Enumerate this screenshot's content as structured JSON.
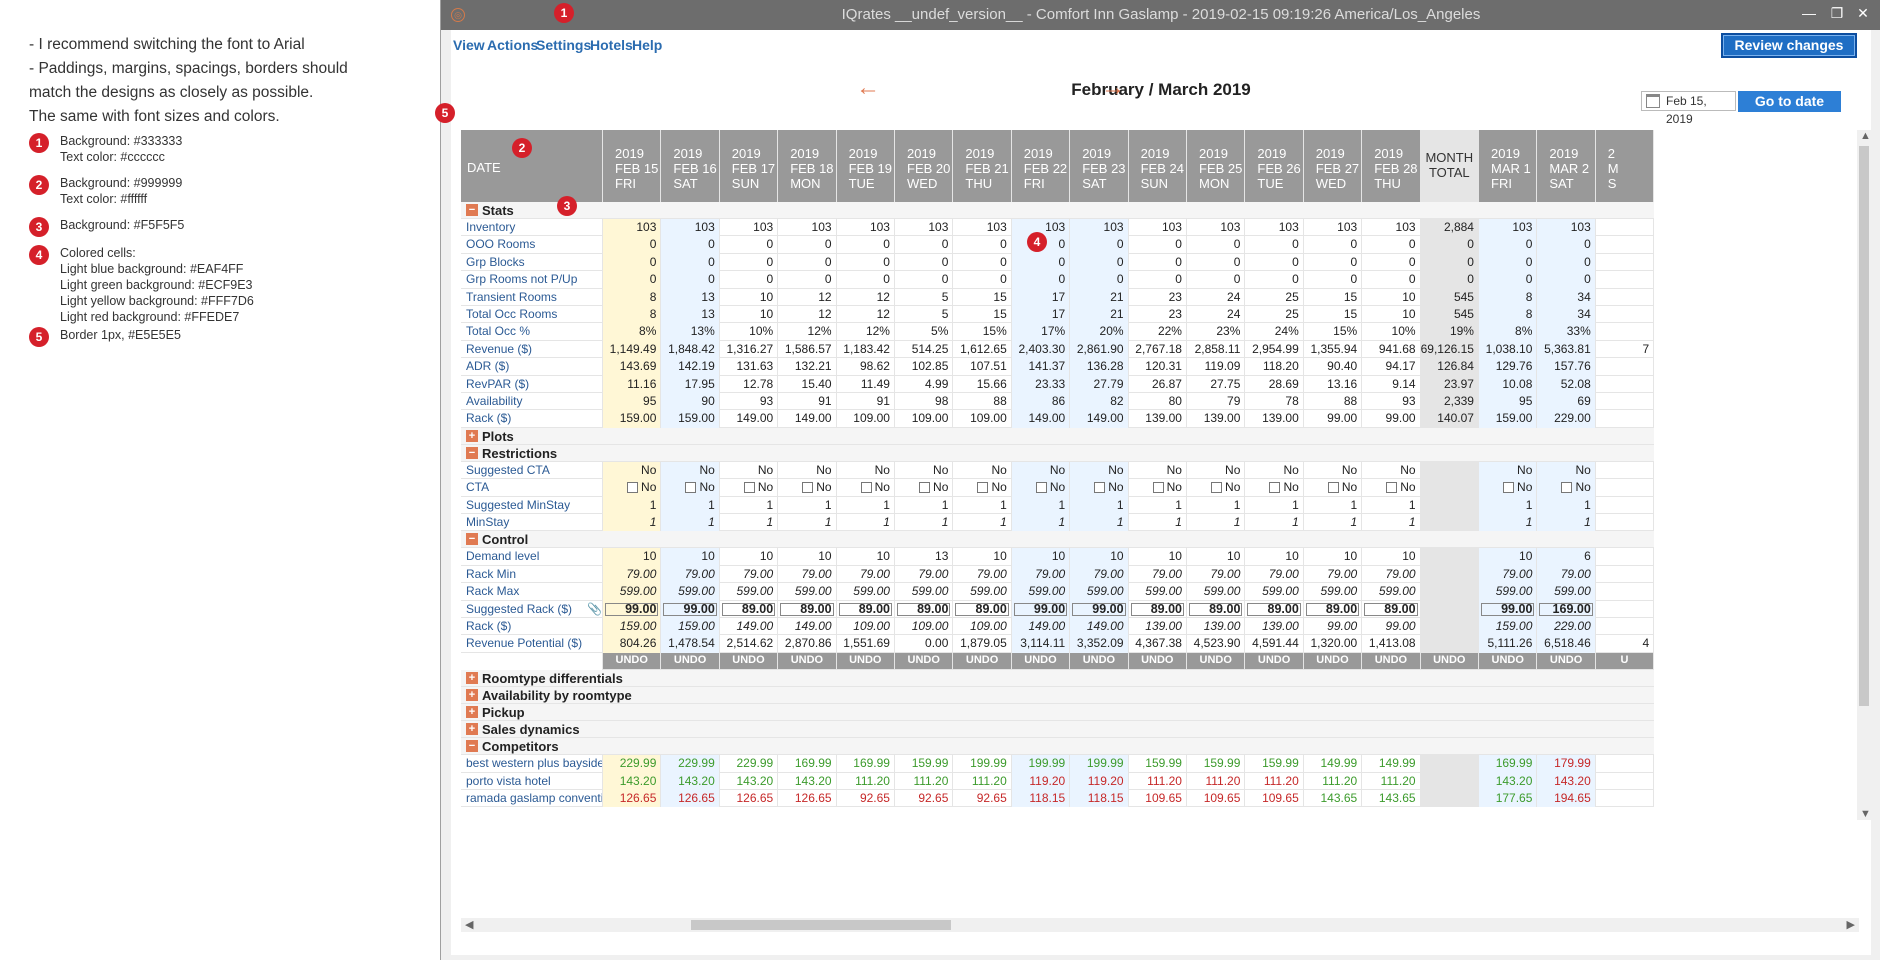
{
  "notes": {
    "lines": [
      "- I recommend switching the font to Arial",
      "- Paddings, margins, spacings, borders should",
      "match the designs as closely as possible.",
      "The same with font sizes and colors."
    ],
    "legend": [
      {
        "num": "1",
        "lines": [
          "Background: #333333",
          "Text color: #cccccc"
        ]
      },
      {
        "num": "2",
        "lines": [
          "Background: #999999",
          "Text color: #ffffff"
        ]
      },
      {
        "num": "3",
        "lines": [
          "Background: #F5F5F5"
        ]
      },
      {
        "num": "4",
        "lines": [
          "Colored cells:",
          "Light blue background: #EAF4FF",
          "Light green background: #ECF9E3",
          "Light yellow background: #FFF7D6",
          "Light red background: #FFEDE7"
        ]
      },
      {
        "num": "5",
        "lines": [
          "Border 1px, #E5E5E5"
        ]
      }
    ]
  },
  "window": {
    "title": "IQrates __undef_version__ - Comfort Inn Gaslamp - 2019-02-15 09:19:26 America/Los_Angeles",
    "icon": "app-logo-icon",
    "controls": {
      "minimize": "—",
      "maximize": "❐",
      "close": "✕"
    }
  },
  "menu": {
    "items": [
      "View",
      "Actions",
      "Settings",
      "Hotels",
      "Help"
    ],
    "review_label": "Review changes"
  },
  "nav": {
    "month_title": "February / March 2019",
    "prev_arrow": "←",
    "next_arrow": "→",
    "date_value": "Feb 15, 2019",
    "goto_label": "Go to date"
  },
  "grid": {
    "date_header": "DATE",
    "total_header": [
      "MONTH",
      "TOTAL"
    ],
    "columns": [
      {
        "year": "2019",
        "date": "FEB 15",
        "dow": "FRI",
        "kind": "yellow"
      },
      {
        "year": "2019",
        "date": "FEB 16",
        "dow": "SAT",
        "kind": "blue"
      },
      {
        "year": "2019",
        "date": "FEB 17",
        "dow": "SUN",
        "kind": ""
      },
      {
        "year": "2019",
        "date": "FEB 18",
        "dow": "MON",
        "kind": ""
      },
      {
        "year": "2019",
        "date": "FEB 19",
        "dow": "TUE",
        "kind": ""
      },
      {
        "year": "2019",
        "date": "FEB 20",
        "dow": "WED",
        "kind": ""
      },
      {
        "year": "2019",
        "date": "FEB 21",
        "dow": "THU",
        "kind": ""
      },
      {
        "year": "2019",
        "date": "FEB 22",
        "dow": "FRI",
        "kind": "blue"
      },
      {
        "year": "2019",
        "date": "FEB 23",
        "dow": "SAT",
        "kind": "blue"
      },
      {
        "year": "2019",
        "date": "FEB 24",
        "dow": "SUN",
        "kind": ""
      },
      {
        "year": "2019",
        "date": "FEB 25",
        "dow": "MON",
        "kind": ""
      },
      {
        "year": "2019",
        "date": "FEB 26",
        "dow": "TUE",
        "kind": ""
      },
      {
        "year": "2019",
        "date": "FEB 27",
        "dow": "WED",
        "kind": ""
      },
      {
        "year": "2019",
        "date": "FEB 28",
        "dow": "THU",
        "kind": ""
      },
      {
        "year": "",
        "date": "",
        "dow": "",
        "kind": "total"
      },
      {
        "year": "2019",
        "date": "MAR 1",
        "dow": "FRI",
        "kind": "blue"
      },
      {
        "year": "2019",
        "date": "MAR 2",
        "dow": "SAT",
        "kind": "blue"
      },
      {
        "year": "2",
        "date": "M",
        "dow": "S",
        "kind": ""
      }
    ],
    "rows": [
      {
        "type": "section",
        "sign": "−",
        "label": "Stats"
      },
      {
        "type": "data",
        "label": "Inventory",
        "values": [
          "103",
          "103",
          "103",
          "103",
          "103",
          "103",
          "103",
          "103",
          "103",
          "103",
          "103",
          "103",
          "103",
          "103",
          "2,884",
          "103",
          "103",
          ""
        ]
      },
      {
        "type": "data",
        "label": "OOO Rooms",
        "values": [
          "0",
          "0",
          "0",
          "0",
          "0",
          "0",
          "0",
          "0",
          "0",
          "0",
          "0",
          "0",
          "0",
          "0",
          "0",
          "0",
          "0",
          ""
        ]
      },
      {
        "type": "data",
        "label": "Grp Blocks",
        "values": [
          "0",
          "0",
          "0",
          "0",
          "0",
          "0",
          "0",
          "0",
          "0",
          "0",
          "0",
          "0",
          "0",
          "0",
          "0",
          "0",
          "0",
          ""
        ]
      },
      {
        "type": "data",
        "label": "Grp Rooms not P/Up",
        "values": [
          "0",
          "0",
          "0",
          "0",
          "0",
          "0",
          "0",
          "0",
          "0",
          "0",
          "0",
          "0",
          "0",
          "0",
          "0",
          "0",
          "0",
          ""
        ]
      },
      {
        "type": "data",
        "label": "Transient Rooms",
        "values": [
          "8",
          "13",
          "10",
          "12",
          "12",
          "5",
          "15",
          "17",
          "21",
          "23",
          "24",
          "25",
          "15",
          "10",
          "545",
          "8",
          "34",
          ""
        ]
      },
      {
        "type": "data",
        "label": "Total Occ Rooms",
        "values": [
          "8",
          "13",
          "10",
          "12",
          "12",
          "5",
          "15",
          "17",
          "21",
          "23",
          "24",
          "25",
          "15",
          "10",
          "545",
          "8",
          "34",
          ""
        ]
      },
      {
        "type": "data",
        "label": "Total Occ %",
        "values": [
          "8%",
          "13%",
          "10%",
          "12%",
          "12%",
          "5%",
          "15%",
          "17%",
          "20%",
          "22%",
          "23%",
          "24%",
          "15%",
          "10%",
          "19%",
          "8%",
          "33%",
          ""
        ]
      },
      {
        "type": "data",
        "label": "Revenue ($)",
        "values": [
          "1,149.49",
          "1,848.42",
          "1,316.27",
          "1,586.57",
          "1,183.42",
          "514.25",
          "1,612.65",
          "2,403.30",
          "2,861.90",
          "2,767.18",
          "2,858.11",
          "2,954.99",
          "1,355.94",
          "941.68",
          "69,126.15",
          "1,038.10",
          "5,363.81",
          "7"
        ]
      },
      {
        "type": "data",
        "label": "ADR ($)",
        "values": [
          "143.69",
          "142.19",
          "131.63",
          "132.21",
          "98.62",
          "102.85",
          "107.51",
          "141.37",
          "136.28",
          "120.31",
          "119.09",
          "118.20",
          "90.40",
          "94.17",
          "126.84",
          "129.76",
          "157.76",
          ""
        ]
      },
      {
        "type": "data",
        "label": "RevPAR ($)",
        "values": [
          "11.16",
          "17.95",
          "12.78",
          "15.40",
          "11.49",
          "4.99",
          "15.66",
          "23.33",
          "27.79",
          "26.87",
          "27.75",
          "28.69",
          "13.16",
          "9.14",
          "23.97",
          "10.08",
          "52.08",
          ""
        ]
      },
      {
        "type": "data",
        "label": "Availability",
        "values": [
          "95",
          "90",
          "93",
          "91",
          "91",
          "98",
          "88",
          "86",
          "82",
          "80",
          "79",
          "78",
          "88",
          "93",
          "2,339",
          "95",
          "69",
          ""
        ]
      },
      {
        "type": "data",
        "label": "Rack ($)",
        "values": [
          "159.00",
          "159.00",
          "149.00",
          "149.00",
          "109.00",
          "109.00",
          "109.00",
          "149.00",
          "149.00",
          "139.00",
          "139.00",
          "139.00",
          "99.00",
          "99.00",
          "140.07",
          "159.00",
          "229.00",
          ""
        ]
      },
      {
        "type": "section",
        "sign": "+",
        "label": "Plots"
      },
      {
        "type": "section",
        "sign": "−",
        "label": "Restrictions"
      },
      {
        "type": "data",
        "label": "Suggested CTA",
        "values": [
          "No",
          "No",
          "No",
          "No",
          "No",
          "No",
          "No",
          "No",
          "No",
          "No",
          "No",
          "No",
          "No",
          "No",
          "",
          "No",
          "No",
          ""
        ]
      },
      {
        "type": "check",
        "label": "CTA",
        "values": [
          "No",
          "No",
          "No",
          "No",
          "No",
          "No",
          "No",
          "No",
          "No",
          "No",
          "No",
          "No",
          "No",
          "No",
          "",
          "No",
          "No",
          ""
        ]
      },
      {
        "type": "data",
        "label": "Suggested MinStay",
        "values": [
          "1",
          "1",
          "1",
          "1",
          "1",
          "1",
          "1",
          "1",
          "1",
          "1",
          "1",
          "1",
          "1",
          "1",
          "",
          "1",
          "1",
          ""
        ]
      },
      {
        "type": "data",
        "label": "MinStay",
        "italic": true,
        "values": [
          "1",
          "1",
          "1",
          "1",
          "1",
          "1",
          "1",
          "1",
          "1",
          "1",
          "1",
          "1",
          "1",
          "1",
          "",
          "1",
          "1",
          ""
        ]
      },
      {
        "type": "section",
        "sign": "−",
        "label": "Control"
      },
      {
        "type": "data",
        "label": "Demand level",
        "values": [
          "10",
          "10",
          "10",
          "10",
          "10",
          "13",
          "10",
          "10",
          "10",
          "10",
          "10",
          "10",
          "10",
          "10",
          "",
          "10",
          "6",
          ""
        ]
      },
      {
        "type": "data",
        "label": "Rack Min",
        "italic": true,
        "values": [
          "79.00",
          "79.00",
          "79.00",
          "79.00",
          "79.00",
          "79.00",
          "79.00",
          "79.00",
          "79.00",
          "79.00",
          "79.00",
          "79.00",
          "79.00",
          "79.00",
          "",
          "79.00",
          "79.00",
          ""
        ]
      },
      {
        "type": "data",
        "label": "Rack Max",
        "italic": true,
        "values": [
          "599.00",
          "599.00",
          "599.00",
          "599.00",
          "599.00",
          "599.00",
          "599.00",
          "599.00",
          "599.00",
          "599.00",
          "599.00",
          "599.00",
          "599.00",
          "599.00",
          "",
          "599.00",
          "599.00",
          ""
        ]
      },
      {
        "type": "bold",
        "label": "Suggested Rack ($)",
        "values": [
          "99.00",
          "99.00",
          "89.00",
          "89.00",
          "89.00",
          "89.00",
          "89.00",
          "99.00",
          "99.00",
          "89.00",
          "89.00",
          "89.00",
          "89.00",
          "89.00",
          "",
          "99.00",
          "169.00",
          ""
        ]
      },
      {
        "type": "data",
        "label": "Rack ($)",
        "italic": true,
        "values": [
          "159.00",
          "159.00",
          "149.00",
          "149.00",
          "109.00",
          "109.00",
          "109.00",
          "149.00",
          "149.00",
          "139.00",
          "139.00",
          "139.00",
          "99.00",
          "99.00",
          "",
          "159.00",
          "229.00",
          ""
        ]
      },
      {
        "type": "data",
        "label": "Revenue Potential ($)",
        "values": [
          "804.26",
          "1,478.54",
          "2,514.62",
          "2,870.86",
          "1,551.69",
          "0.00",
          "1,879.05",
          "3,114.11",
          "3,352.09",
          "4,367.38",
          "4,523.90",
          "4,591.44",
          "1,320.00",
          "1,413.08",
          "",
          "5,111.26",
          "6,518.46",
          "4"
        ]
      },
      {
        "type": "undo",
        "label": "",
        "values": [
          "UNDO",
          "UNDO",
          "UNDO",
          "UNDO",
          "UNDO",
          "UNDO",
          "UNDO",
          "UNDO",
          "UNDO",
          "UNDO",
          "UNDO",
          "UNDO",
          "UNDO",
          "UNDO",
          "UNDO",
          "UNDO",
          "UNDO",
          "U"
        ]
      },
      {
        "type": "section",
        "sign": "+",
        "label": "Roomtype differentials"
      },
      {
        "type": "section",
        "sign": "+",
        "label": "Availability by roomtype"
      },
      {
        "type": "section",
        "sign": "+",
        "label": "Pickup"
      },
      {
        "type": "section",
        "sign": "+",
        "label": "Sales dynamics"
      },
      {
        "type": "section",
        "sign": "−",
        "label": "Competitors"
      },
      {
        "type": "comp",
        "label": "best western plus bayside inn",
        "values": [
          "229.99",
          "229.99",
          "229.99",
          "169.99",
          "169.99",
          "159.99",
          "199.99",
          "199.99",
          "199.99",
          "159.99",
          "159.99",
          "159.99",
          "149.99",
          "149.99",
          "",
          "169.99",
          "179.99",
          ""
        ],
        "colors": [
          "g",
          "g",
          "g",
          "g",
          "g",
          "g",
          "g",
          "g",
          "g",
          "g",
          "g",
          "g",
          "g",
          "g",
          "",
          "g",
          "r",
          ""
        ]
      },
      {
        "type": "comp",
        "label": "porto vista hotel",
        "values": [
          "143.20",
          "143.20",
          "143.20",
          "143.20",
          "111.20",
          "111.20",
          "111.20",
          "119.20",
          "119.20",
          "111.20",
          "111.20",
          "111.20",
          "111.20",
          "111.20",
          "",
          "143.20",
          "143.20",
          ""
        ],
        "colors": [
          "g",
          "g",
          "g",
          "g",
          "g",
          "g",
          "g",
          "r",
          "r",
          "r",
          "r",
          "r",
          "g",
          "g",
          "",
          "g",
          "r",
          ""
        ]
      },
      {
        "type": "comp",
        "label": "ramada gaslamp convention",
        "values": [
          "126.65",
          "126.65",
          "126.65",
          "126.65",
          "92.65",
          "92.65",
          "92.65",
          "118.15",
          "118.15",
          "109.65",
          "109.65",
          "109.65",
          "143.65",
          "143.65",
          "",
          "177.65",
          "194.65",
          ""
        ],
        "colors": [
          "r",
          "r",
          "r",
          "r",
          "r",
          "r",
          "r",
          "r",
          "r",
          "r",
          "r",
          "r",
          "g",
          "g",
          "",
          "g",
          "r",
          ""
        ]
      }
    ]
  },
  "annotations": [
    "1",
    "2",
    "3",
    "4",
    "5"
  ]
}
